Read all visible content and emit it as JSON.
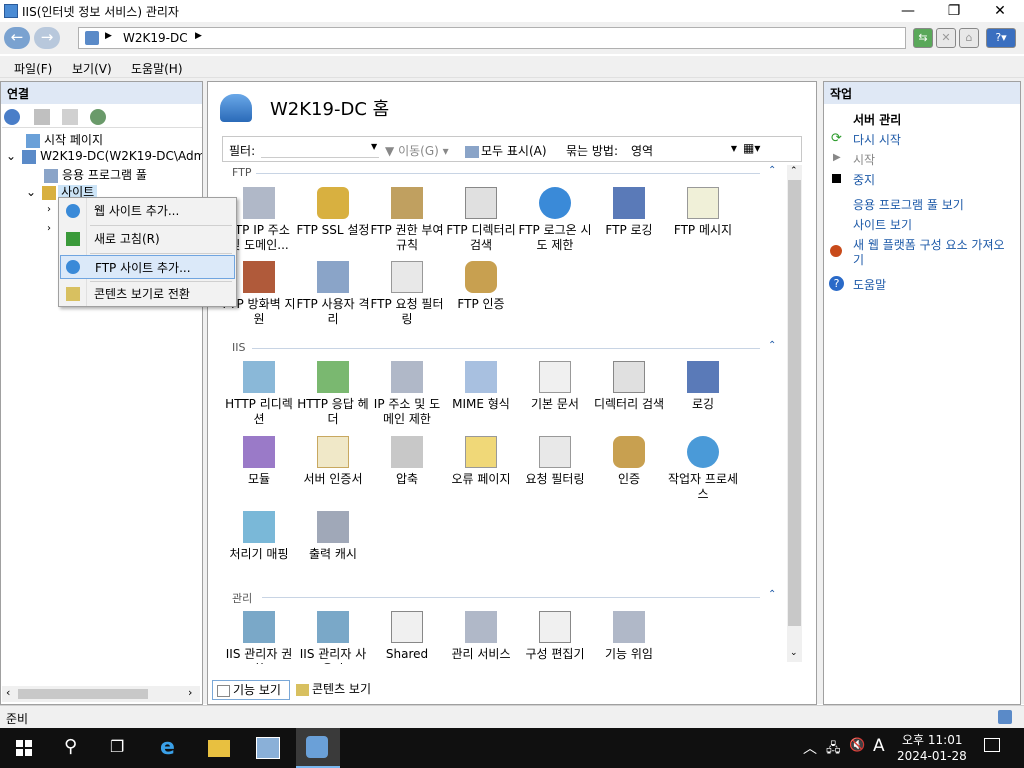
{
  "window": {
    "title": "IIS(인터넷 정보 서비스) 관리자"
  },
  "address": {
    "host": "W2K19-DC"
  },
  "menu": [
    "파일(F)",
    "보기(V)",
    "도움말(H)"
  ],
  "connections": {
    "header": "연결",
    "tree": [
      "시작 페이지",
      "W2K19-DC(W2K19-DC\\Adm",
      "응용 프로그램 풀",
      "사이트"
    ]
  },
  "context_menu": {
    "items": [
      "웹 사이트 추가...",
      "새로 고침(R)",
      "FTP 사이트 추가...",
      "콘텐츠 보기로 전환"
    ]
  },
  "main": {
    "title": "W2K19-DC 홈",
    "filter": {
      "label": "필터:",
      "go": "이동(G)",
      "show_all": "모두 표시(A)",
      "group_label": "묶는 방법:",
      "group_value": "영역"
    },
    "sections": [
      {
        "name": "FTP",
        "items": [
          "FTP IP 주소 및 도메인...",
          "FTP SSL 설정",
          "FTP 권한 부여 규칙",
          "FTP 디렉터리 검색",
          "FTP 로그온 시도 제한",
          "FTP 로깅",
          "FTP 메시지",
          "FTP 방화벽 지원",
          "FTP 사용자 격리",
          "FTP 요청 필터링",
          "FTP 인증"
        ]
      },
      {
        "name": "IIS",
        "items": [
          "HTTP 리디렉션",
          "HTTP 응답 헤더",
          "IP 주소 및 도메인 제한",
          "MIME 형식",
          "기본 문서",
          "디렉터리 검색",
          "로깅",
          "모듈",
          "서버 인증서",
          "압축",
          "오류 페이지",
          "요청 필터링",
          "인증",
          "작업자 프로세스",
          "처리기 매핑",
          "출력 캐시"
        ]
      },
      {
        "name": "관리",
        "items": [
          "IIS 관리자 권한",
          "IIS 관리자 사용자",
          "Shared",
          "관리 서비스",
          "구성 편집기",
          "기능 위임"
        ]
      }
    ],
    "tabs": {
      "features": "기능 보기",
      "content": "콘텐츠 보기"
    }
  },
  "actions": {
    "header": "작업",
    "group": "서버 관리",
    "items": [
      "다시 시작",
      "시작",
      "중지",
      "응용 프로그램 풀 보기",
      "사이트 보기",
      "새 웹 플랫폼 구성 요소 가져오기",
      "도움말"
    ]
  },
  "status": {
    "text": "준비"
  },
  "taskbar": {
    "time": "오후 11:01",
    "date": "2024-01-28",
    "ime": "A"
  }
}
